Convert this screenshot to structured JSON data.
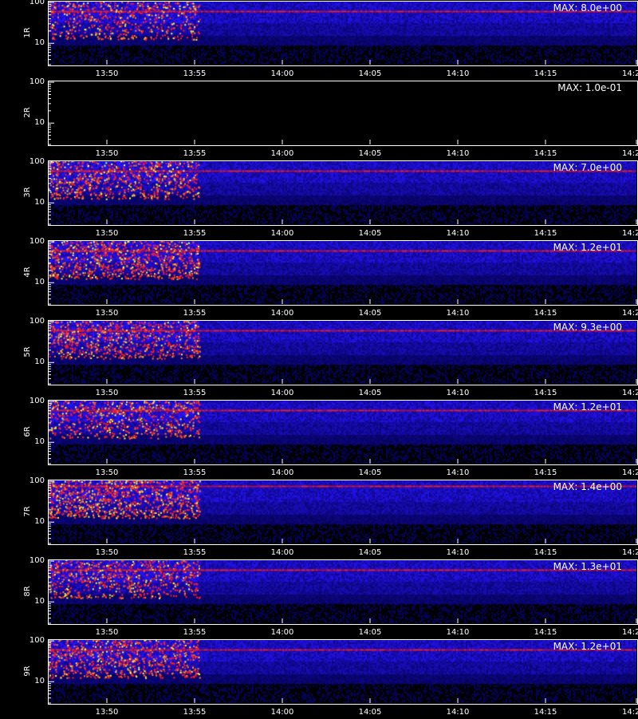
{
  "xaxis_title": "",
  "colors": {
    "background": "#000000",
    "low": "#1f1fc9",
    "mid": "#ff2020",
    "high": "#ffff30"
  },
  "chart_data": [
    {
      "type": "heatmap",
      "channel": "1R",
      "max_label": "MAX: 8.0e+00",
      "ytick_labels": [
        "100",
        "10"
      ],
      "ylim": [
        3,
        110
      ],
      "xtick_labels": [
        "13:50",
        "13:55",
        "14:00",
        "14:05",
        "14:10",
        "14:15",
        "14:2"
      ],
      "band_y": 60,
      "activity": 0.6
    },
    {
      "type": "heatmap",
      "channel": "2R",
      "max_label": "MAX: 1.0e-01",
      "ytick_labels": [
        "100",
        "10"
      ],
      "ylim": [
        3,
        110
      ],
      "xtick_labels": [
        "13:50",
        "13:55",
        "14:00",
        "14:05",
        "14:10",
        "14:15",
        "14:2"
      ],
      "band_y": null,
      "activity": 0
    },
    {
      "type": "heatmap",
      "channel": "3R",
      "max_label": "MAX: 7.0e+00",
      "ytick_labels": [
        "100",
        "10"
      ],
      "ylim": [
        3,
        110
      ],
      "xtick_labels": [
        "13:50",
        "13:55",
        "14:00",
        "14:05",
        "14:10",
        "14:15",
        "14:2"
      ],
      "band_y": 60,
      "activity": 0.8
    },
    {
      "type": "heatmap",
      "channel": "4R",
      "max_label": "MAX: 1.2e+01",
      "ytick_labels": [
        "100",
        "10"
      ],
      "ylim": [
        3,
        110
      ],
      "xtick_labels": [
        "13:50",
        "13:55",
        "14:00",
        "14:05",
        "14:10",
        "14:15",
        "14:2"
      ],
      "band_y": 60,
      "activity": 0.9
    },
    {
      "type": "heatmap",
      "channel": "5R",
      "max_label": "MAX: 9.3e+00",
      "ytick_labels": [
        "100",
        "10"
      ],
      "ylim": [
        3,
        110
      ],
      "xtick_labels": [
        "13:50",
        "13:55",
        "14:00",
        "14:05",
        "14:10",
        "14:15",
        "14:2"
      ],
      "band_y": 60,
      "activity": 0.8
    },
    {
      "type": "heatmap",
      "channel": "6R",
      "max_label": "MAX: 1.2e+01",
      "ytick_labels": [
        "100",
        "10"
      ],
      "ylim": [
        3,
        110
      ],
      "xtick_labels": [
        "13:50",
        "13:55",
        "14:00",
        "14:05",
        "14:10",
        "14:15",
        "14:2"
      ],
      "band_y": 60,
      "activity": 0.7
    },
    {
      "type": "heatmap",
      "channel": "7R",
      "max_label": "MAX: 1.4e+00",
      "ytick_labels": [
        "100",
        "10"
      ],
      "ylim": [
        3,
        110
      ],
      "xtick_labels": [
        "13:50",
        "13:55",
        "14:00",
        "14:05",
        "14:10",
        "14:15",
        "14:2"
      ],
      "band_y": 75,
      "activity": 1.0
    },
    {
      "type": "heatmap",
      "channel": "8R",
      "max_label": "MAX: 1.3e+01",
      "ytick_labels": [
        "100",
        "10"
      ],
      "ylim": [
        3,
        110
      ],
      "xtick_labels": [
        "13:50",
        "13:55",
        "14:00",
        "14:05",
        "14:10",
        "14:15",
        "14:2"
      ],
      "band_y": 60,
      "activity": 0.7
    },
    {
      "type": "heatmap",
      "channel": "9R",
      "max_label": "MAX: 1.2e+01",
      "ytick_labels": [
        "100",
        "10"
      ],
      "ylim": [
        3,
        110
      ],
      "xtick_labels": [
        "13:50",
        "13:55",
        "14:00",
        "14:05",
        "14:10",
        "14:15",
        "14:2"
      ],
      "band_y": 60,
      "activity": 0.8
    }
  ]
}
